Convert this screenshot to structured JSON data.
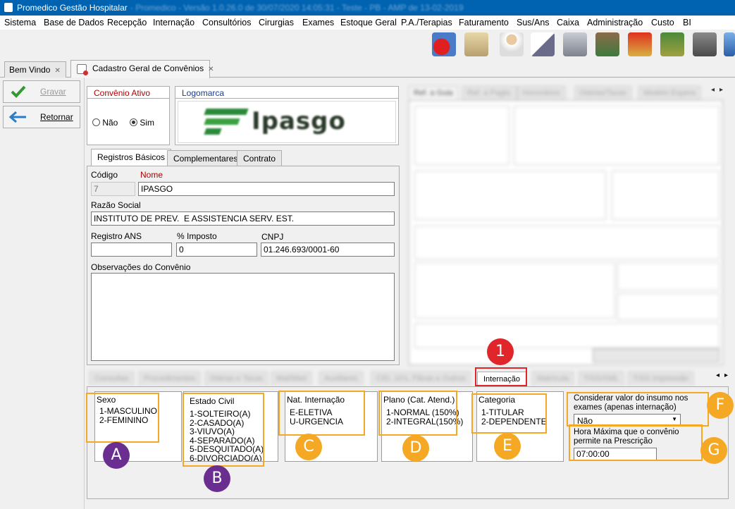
{
  "window": {
    "title": "Promedico Gestão Hospitalar",
    "title_extra": "- Promedico - Versão 1.0.26.0 de 30/07/2020 14:05:31 - Teste - PB - AMP de 13-02-2019"
  },
  "menu": [
    "Sistema",
    "Base de Dados",
    "Recepção",
    "Internação",
    "Consultórios",
    "Cirurgias",
    "Exames",
    "Estoque Geral",
    "P.A./Terapias",
    "Faturamento",
    "Sus/Ans",
    "Caixa",
    "Administração",
    "Custo",
    "BI"
  ],
  "toolbar_icons": [
    "users-refresh-icon",
    "doctor-card-icon",
    "doctor-icon",
    "prescription-icon",
    "printer-icon",
    "cash-register-icon",
    "stock-up-icon",
    "stock-down-icon",
    "safe-icon",
    "globe-icon"
  ],
  "page_tabs": [
    {
      "label": "Bem Vindo",
      "close": "✕"
    },
    {
      "label": "Cadastro Geral de Convênios",
      "close": "✕"
    }
  ],
  "side": {
    "save_label": "Gravar",
    "back_label": "Retornar"
  },
  "convenio_ativo": {
    "title": "Convênio Ativo",
    "no": "Não",
    "yes": "Sim",
    "selected": "Sim"
  },
  "logomarca": {
    "title": "Logomarca",
    "logo_text": "Ipasgo"
  },
  "form_tabs": [
    "Registros Básicos",
    "Complementares",
    "Contrato"
  ],
  "form": {
    "codigo_label": "Código",
    "codigo": "7",
    "nome_label": "Nome",
    "nome": "IPASGO",
    "razao_label": "Razão Social",
    "razao": "INSTITUTO DE PREV.  E ASSISTENCIA SERV. EST.",
    "ans_label": "Registro ANS",
    "ans": "",
    "imposto_label": "% Imposto",
    "imposto": "0",
    "cnpj_label": "CNPJ",
    "cnpj": "01.246.693/0001-60",
    "obs_label": "Observações do Convênio",
    "obs": ""
  },
  "right_tabs": [
    "Ref. a Guia",
    "Ref. a Pagto.",
    "Honorários",
    "Diárias/Taxas",
    "Modelo Espera"
  ],
  "bottom_tabs": [
    "Consultas",
    "Procedimentos",
    "Diárias e Taxas",
    "Mat/Med",
    "Auxiliares",
    "CID, 10's, Fibras e Outros",
    "Internação",
    "Matrícula",
    "TISS/XML",
    "TISS Impressão"
  ],
  "bottom_active_tab": "Internação",
  "internacao": {
    "sexo": {
      "label": "Sexo",
      "items": [
        "1-MASCULINO",
        "2-FEMININO"
      ]
    },
    "estado_civil": {
      "label": "Estado Civil",
      "items": [
        "1-SOLTEIRO(A)",
        "2-CASADO(A)",
        "3-VIUVO(A)",
        "4-SEPARADO(A)",
        "5-DESQUITADO(A)",
        "6-DIVORCIADO(A)"
      ]
    },
    "nat_internacao": {
      "label": "Nat. Internação",
      "items": [
        "E-ELETIVA",
        "U-URGENCIA"
      ]
    },
    "plano": {
      "label": "Plano (Cat. Atend.)",
      "items": [
        "1-NORMAL (150%)",
        "2-INTEGRAL(150%)"
      ]
    },
    "categoria": {
      "label": "Categoria",
      "items": [
        "1-TITULAR",
        "2-DEPENDENTE"
      ]
    },
    "considerar_label": "Considerar valor do insumo nos exames (apenas internação)",
    "considerar_value": "Não",
    "hora_label": "Hora Máxima que o convênio permite na Prescrição",
    "hora_value": "07:00:00"
  },
  "badges": [
    "1",
    "A",
    "B",
    "C",
    "D",
    "E",
    "F",
    "G"
  ],
  "colors": {
    "titlebar": "#0063b1",
    "highlight": "#f4a824",
    "purple": "#6a2e91",
    "red": "#e0262a",
    "group_title": "#1a3c8a",
    "nome_label": "#b00000"
  }
}
